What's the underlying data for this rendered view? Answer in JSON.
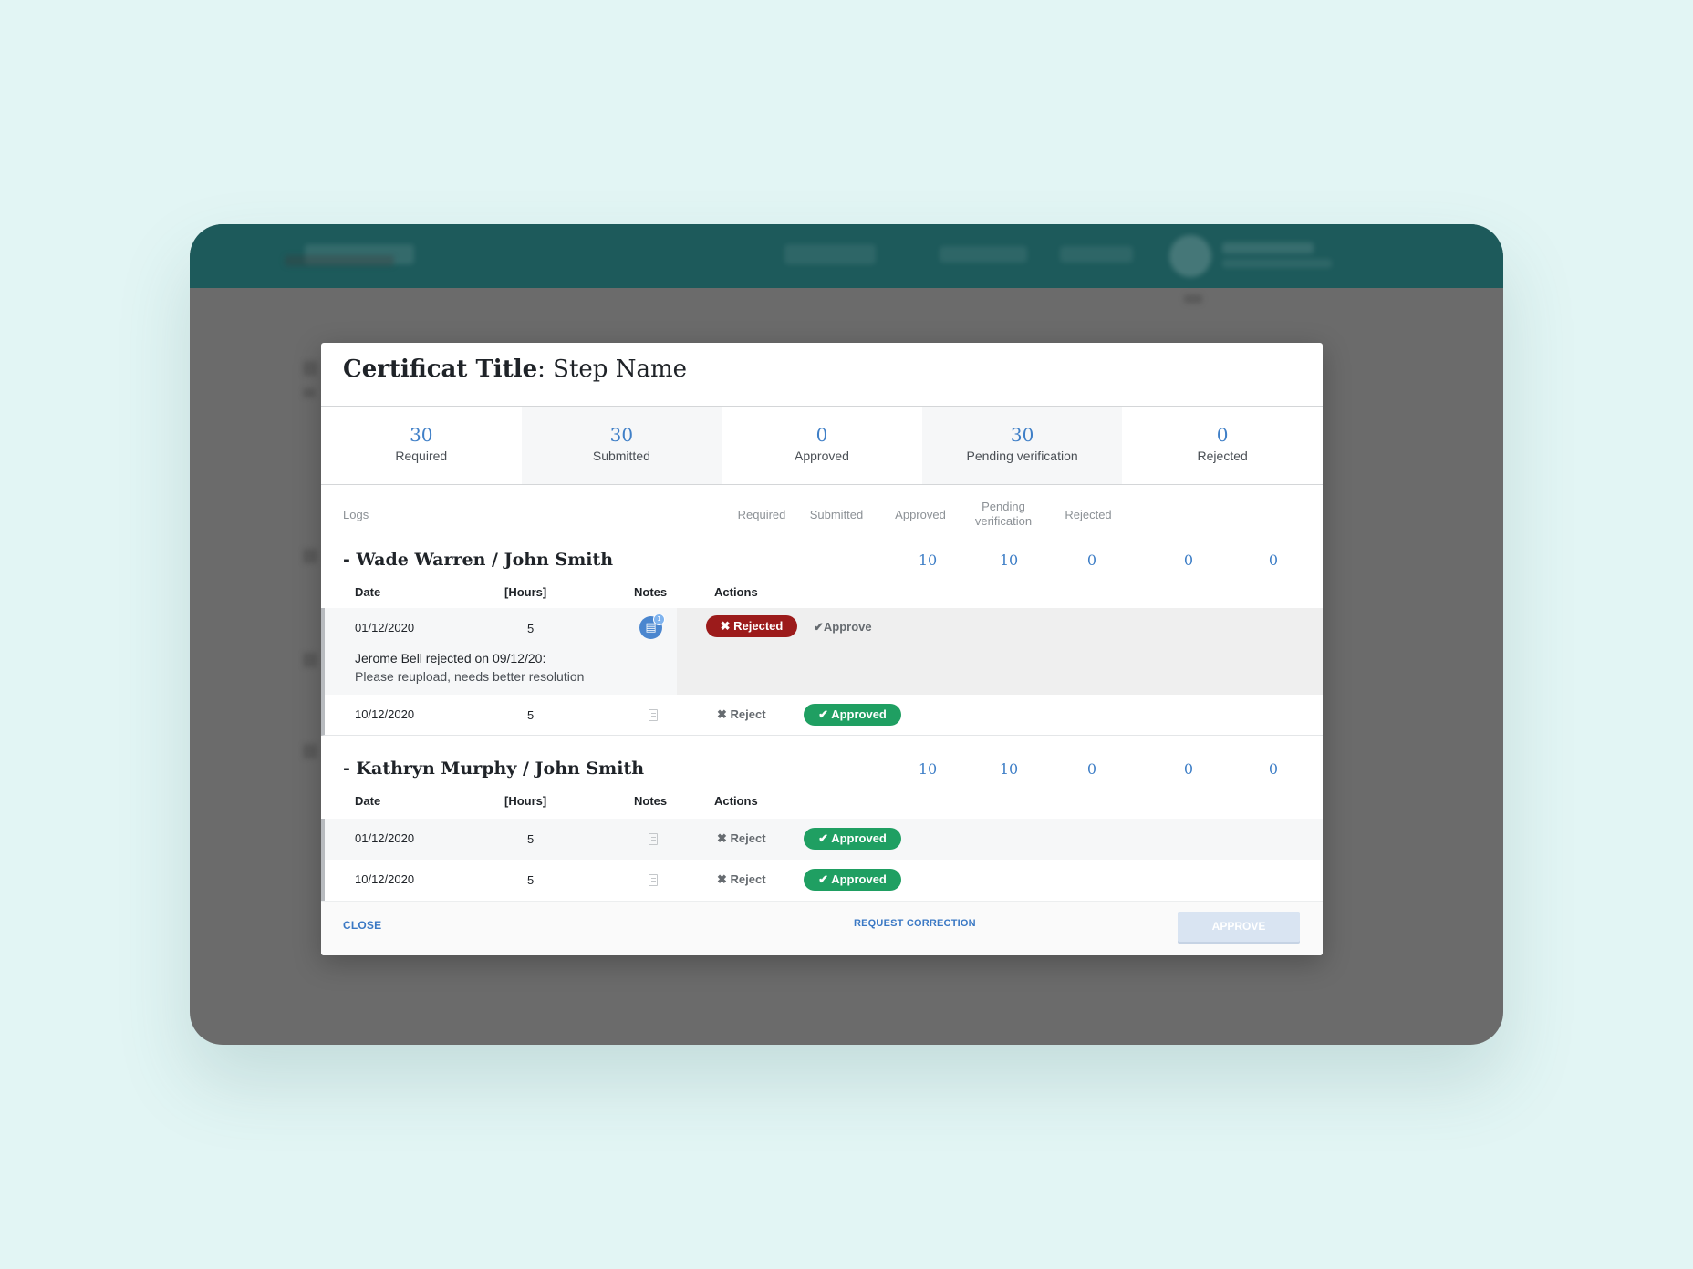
{
  "modal": {
    "title_strong": "Certificat Title",
    "title_rest": ": Step Name"
  },
  "stats": [
    {
      "value": "30",
      "label": "Required"
    },
    {
      "value": "30",
      "label": "Submitted"
    },
    {
      "value": "0",
      "label": "Approved"
    },
    {
      "value": "30",
      "label": "Pending verification"
    },
    {
      "value": "0",
      "label": "Rejected"
    }
  ],
  "columns": {
    "logs": "Logs",
    "required": "Required",
    "submitted": "Submitted",
    "approved": "Approved",
    "pending_line1": "Pending",
    "pending_line2": "verification",
    "rejected": "Rejected"
  },
  "table_headers": {
    "date": "Date",
    "hours": "[Hours]",
    "notes": "Notes",
    "actions": "Actions"
  },
  "groups": [
    {
      "name": "- Wade Warren / John Smith",
      "values": [
        "10",
        "10",
        "0",
        "0",
        "0"
      ],
      "rows": [
        {
          "date": "01/12/2020",
          "hours": "5",
          "status": "Rejected",
          "secondary_action": "Approve",
          "note_line1": "Jerome Bell rejected on 09/12/20:",
          "note_line2": "Please reupload, needs better resolution",
          "note_badge": "1"
        },
        {
          "date": "10/12/2020",
          "hours": "5",
          "secondary_action": "Reject",
          "status": "Approved"
        }
      ]
    },
    {
      "name": "- Kathryn Murphy / John Smith",
      "values": [
        "10",
        "10",
        "0",
        "0",
        "0"
      ],
      "rows": [
        {
          "date": "01/12/2020",
          "hours": "5",
          "secondary_action": "Reject",
          "status": "Approved"
        },
        {
          "date": "10/12/2020",
          "hours": "5",
          "secondary_action": "Reject",
          "status": "Approved"
        }
      ]
    }
  ],
  "footer": {
    "close": "CLOSE",
    "request_correction": "REQUEST CORRECTION",
    "approve": "APPROVE"
  },
  "icons": {
    "rejected": "x-icon",
    "approve": "check-icon",
    "notes": "document-icon"
  },
  "colors": {
    "accent": "#3f7fc7",
    "rejected": "#9c1b1b",
    "approved": "#1f9f62",
    "header": "#1d5a5b"
  }
}
